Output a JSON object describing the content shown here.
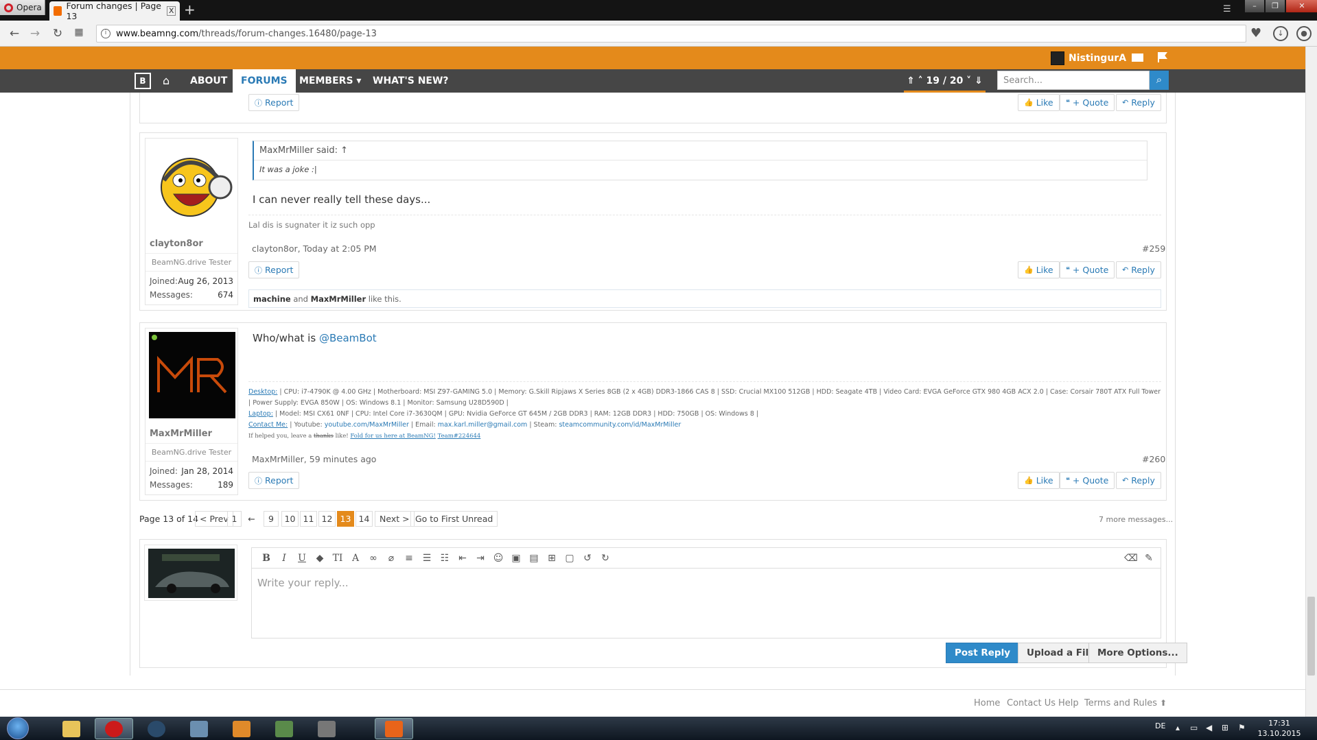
{
  "browser": {
    "app_name": "Opera",
    "tab_title": "Forum changes | Page 13",
    "tab_close": "x",
    "new_tab": "+",
    "url_domain": "www.beamng.com",
    "url_path": "/threads/forum-changes.16480/page-13"
  },
  "site": {
    "username": "NistingurA",
    "nav": {
      "about": "ABOUT",
      "forums": "FORUMS",
      "members": "MEMBERS ▾",
      "whats_new": "WHAT'S NEW?"
    },
    "page_counter": "⇑ ˄ 19 / 20 ˅ ⇓",
    "search_placeholder": "Search..."
  },
  "buttons": {
    "report": "Report",
    "like": "Like",
    "quote": "+ Quote",
    "reply": "Reply"
  },
  "posts": [
    {
      "quote_author": "MaxMrMiller said: ↑",
      "quote_text": "It was a joke :|",
      "message": "I can never really tell these days...",
      "signature": "Lal dis is sugnater it iz such opp",
      "author_time": "clayton8or, Today at 2:05 PM",
      "number": "#259",
      "likes_user1": "machine",
      "likes_and": "and",
      "likes_user2": "MaxMrMiller",
      "likes_suffix": "like this.",
      "user": {
        "name": "clayton8or",
        "title": "BeamNG.drive Tester",
        "joined_label": "Joined:",
        "joined": "Aug 26, 2013",
        "messages_label": "Messages:",
        "messages": "674"
      }
    },
    {
      "message_prefix": "Who/what is",
      "mention": "@BeamBot",
      "sig_desktop_label": "Desktop:",
      "sig_desktop": " | CPU: i7-4790K @ 4.00 GHz | Motherboard: MSI Z97-GAMING 5.0 | Memory: G.Skill Ripjaws X Series 8GB (2 x 4GB) DDR3-1866 CAS 8 | SSD: Crucial MX100 512GB | HDD: Seagate 4TB | Video Card: EVGA GeForce GTX 980 4GB ACX 2.0 | Case: Corsair 780T ATX Full Tower | Power Supply: EVGA 850W | OS: Windows 8.1 | Monitor: Samsung U28D590D |",
      "sig_laptop_label": "Laptop:",
      "sig_laptop": " | Model: MSI CX61 0NF | CPU: Intel Core i7-3630QM | GPU: Nvidia GeForce GT 645M / 2GB DDR3 | RAM: 12GB DDR3 | HDD: 750GB | OS: Windows 8 |",
      "sig_contact_label": "Contact Me:",
      "sig_contact_yt_label": " | Youtube: ",
      "sig_contact_yt": "youtube.com/MaxMrMiller",
      "sig_contact_email_label": " | Email: ",
      "sig_contact_email": "max.karl.miller@gmail.com",
      "sig_contact_steam_label": " | Steam: ",
      "sig_contact_steam": "steamcommunity.com/id/MaxMrMiller",
      "sig_last_text": "If helped you, leave a",
      "sig_last_strike": "thanks",
      "sig_last_like": "like!",
      "sig_last_link1": "Fold for us here at BeamNG!",
      "sig_last_link2": "Team#224644",
      "author_time": "MaxMrMiller, 59 minutes ago",
      "number": "#260",
      "user": {
        "name": "MaxMrMiller",
        "title": "BeamNG.drive Tester",
        "joined_label": "Joined:",
        "joined": "Jan 28, 2014",
        "messages_label": "Messages:",
        "messages": "189"
      }
    }
  ],
  "pagination": {
    "label": "Page 13 of 14",
    "prev": "< Prev",
    "first": "1",
    "ellipsis": "←",
    "pages": [
      "9",
      "10",
      "11",
      "12",
      "13",
      "14"
    ],
    "next": "Next >",
    "first_unread": "Go to First Unread",
    "more_messages": "7 more messages..."
  },
  "editor": {
    "placeholder": "Write your reply...",
    "post_reply": "Post Reply",
    "upload": "Upload a File",
    "more": "More Options..."
  },
  "footer": {
    "home": "Home",
    "contact": "Contact Us",
    "help": "Help",
    "terms": "Terms and Rules"
  },
  "taskbar": {
    "lang": "DE",
    "time": "17:31",
    "date": "13.10.2015"
  },
  "colors": {
    "accent_orange": "#e48a1b",
    "nav_dark": "#464646",
    "link_blue": "#2a7ab5"
  }
}
